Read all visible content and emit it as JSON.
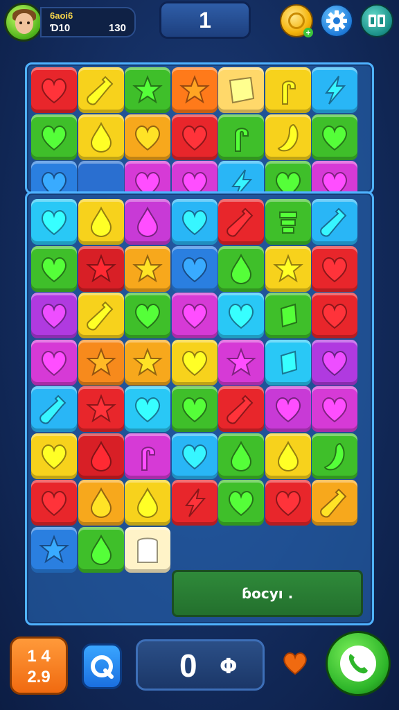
{
  "header": {
    "player_name": "6aoi6",
    "player_level": "Ɗ10",
    "player_coins": "130",
    "level_number": "1",
    "icons": [
      "avatar",
      "coin-icon",
      "gear-icon",
      "cards-icon"
    ]
  },
  "boards": {
    "top": {
      "rows": [
        [
          [
            "#e8262b",
            "heart"
          ],
          [
            "#f7d21c",
            "bottle"
          ],
          [
            "#3fbf2a",
            "star"
          ],
          [
            "#ff7a1a",
            "star"
          ],
          [
            "#ffd86a",
            "scroll"
          ],
          [
            "#f7d21c",
            "cane"
          ],
          [
            "#29b6f6",
            "bolt"
          ]
        ],
        [
          [
            "#3fbf2a",
            "heart"
          ],
          [
            "#f7d21c",
            "drop"
          ],
          [
            "#f7a81c",
            "heart"
          ],
          [
            "#e8262b",
            "heart"
          ],
          [
            "#3fbf2a",
            "cane"
          ],
          [
            "#f7d21c",
            "pepper"
          ],
          [
            "#3fbf2a",
            "heart"
          ]
        ],
        [
          [
            "#2a7fe0",
            "heart"
          ],
          [
            "#2a6fd0",
            "none"
          ],
          [
            "#d63ad6",
            "heart"
          ],
          [
            "#d63ad6",
            "heart"
          ],
          [
            "#29b6f6",
            "bolt"
          ],
          [
            "#3fbf2a",
            "heart"
          ],
          [
            "#d63ad6",
            "heart"
          ]
        ]
      ]
    },
    "main": {
      "rows": [
        [
          [
            "#29c8f6",
            "heart"
          ],
          [
            "#f7d21c",
            "drop"
          ],
          [
            "#c83ad6",
            "drop"
          ],
          [
            "#29b6f6",
            "heart"
          ],
          [
            "#e8262b",
            "bottle"
          ],
          [
            "#3fbf2a",
            "coil"
          ],
          [
            "#29b6f6",
            "bottle"
          ]
        ],
        [
          [
            "#3fbf2a",
            "heart"
          ],
          [
            "#d81f26",
            "star"
          ],
          [
            "#f7a81c",
            "star"
          ],
          [
            "#2a7fe0",
            "heart"
          ],
          [
            "#3fbf2a",
            "drop"
          ],
          [
            "#f7d21c",
            "star"
          ],
          [
            "#e8262b",
            "heart"
          ]
        ],
        [
          [
            "#b03ae0",
            "heart"
          ],
          [
            "#f7d21c",
            "bottle"
          ],
          [
            "#3fbf2a",
            "heart"
          ],
          [
            "#d63ad6",
            "heart"
          ],
          [
            "#29c8f6",
            "heart"
          ],
          [
            "#3fbf2a",
            "bar"
          ],
          [
            "#e8262b",
            "heart"
          ]
        ],
        [
          [
            "#d63ad6",
            "heart"
          ],
          [
            "#f78a1c",
            "star"
          ],
          [
            "#f7a81c",
            "star"
          ],
          [
            "#f7d21c",
            "heart"
          ],
          [
            "#d63ad6",
            "star"
          ],
          [
            "#29c8f6",
            "bar"
          ],
          [
            "#b03ae0",
            "heart"
          ]
        ],
        [
          [
            "#29b6f6",
            "bottle"
          ],
          [
            "#e8262b",
            "star"
          ],
          [
            "#29c8f6",
            "heart"
          ],
          [
            "#3fbf2a",
            "heart"
          ],
          [
            "#e8262b",
            "bottle"
          ],
          [
            "#c83ad6",
            "heart"
          ],
          [
            "#d63ad6",
            "heart"
          ]
        ],
        [
          [
            "#f7d21c",
            "heart"
          ],
          [
            "#d81f26",
            "drop"
          ],
          [
            "#d63ad6",
            "cane"
          ],
          [
            "#29b6f6",
            "heart"
          ],
          [
            "#3fbf2a",
            "drop"
          ],
          [
            "#f7d21c",
            "drop"
          ],
          [
            "#3fbf2a",
            "pepper"
          ]
        ],
        [
          [
            "#e8262b",
            "heart"
          ],
          [
            "#f7a81c",
            "drop"
          ],
          [
            "#f7d21c",
            "drop"
          ],
          [
            "#e8262b",
            "bolt"
          ],
          [
            "#3fbf2a",
            "heart"
          ],
          [
            "#e8262b",
            "heart"
          ],
          [
            "#f7a81c",
            "bottle"
          ]
        ],
        [
          [
            "#2a7fe0",
            "star"
          ],
          [
            "#3fbf2a",
            "drop"
          ],
          [
            "#fff3c8",
            "toast"
          ]
        ]
      ],
      "message_text": "ɓocyı ."
    }
  },
  "footer": {
    "moves_top": "1 4",
    "moves_bottom": "2.9",
    "score_value": "0",
    "score_unit": "Φ",
    "icons": [
      "shuffle-icon",
      "heart-life-icon",
      "phone-icon"
    ]
  },
  "colors": {
    "background": "#132c5e",
    "board_border": "#4fb2ff",
    "message_bg": "#2f8a3a",
    "call_button": "#2eb62a",
    "moves_button": "#f06a10"
  }
}
